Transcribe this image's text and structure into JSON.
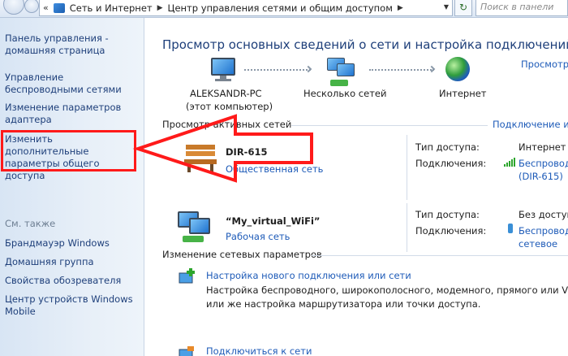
{
  "address_bar": {
    "chevrons": "«",
    "crumbs": [
      "Сеть и Интернет",
      "Центр управления сетями и общим доступом"
    ],
    "search_placeholder": "Поиск в панели"
  },
  "sidebar": {
    "links": [
      "Панель управления - домашняя страница",
      "Управление беспроводными сетями",
      "Изменение параметров адаптера",
      "Изменить дополнительные параметры общего доступа"
    ],
    "see_also_heading": "См. также",
    "see_also": [
      "Брандмауэр Windows",
      "Домашняя группа",
      "Свойства обозревателя",
      "Центр устройств Windows Mobile"
    ]
  },
  "main": {
    "title": "Просмотр основных сведений о сети и настройка подключений",
    "view_full_map": "Просмотр",
    "map": {
      "computer_name": "ALEKSANDR-PC",
      "computer_note": "(этот компьютер)",
      "networks": "Несколько сетей",
      "internet": "Интернет"
    },
    "active_heading": "Просмотр активных сетей",
    "connect_link": "Подключение или",
    "networks_list": [
      {
        "name": "DIR-615",
        "type": "Общественная сеть",
        "access_label": "Тип доступа:",
        "access_value": "Интернет",
        "conn_label": "Подключения:",
        "conn_value": "Беспроводно",
        "conn_value2": "(DIR-615)"
      },
      {
        "name": "“My_virtual_WiFi”",
        "type": "Рабочая сеть",
        "access_label": "Тип доступа:",
        "access_value": "Без доступа",
        "conn_label": "Подключения:",
        "conn_value": "Беспроводно",
        "conn_value2": "сетевое"
      }
    ],
    "change_heading": "Изменение сетевых параметров",
    "actions": [
      {
        "title": "Настройка нового подключения или сети",
        "desc1": "Настройка беспроводного, широкополосного, модемного, прямого или VPN-по",
        "desc2": "или же настройка маршрутизатора или точки доступа."
      },
      {
        "title": "Подключиться к сети"
      }
    ]
  }
}
